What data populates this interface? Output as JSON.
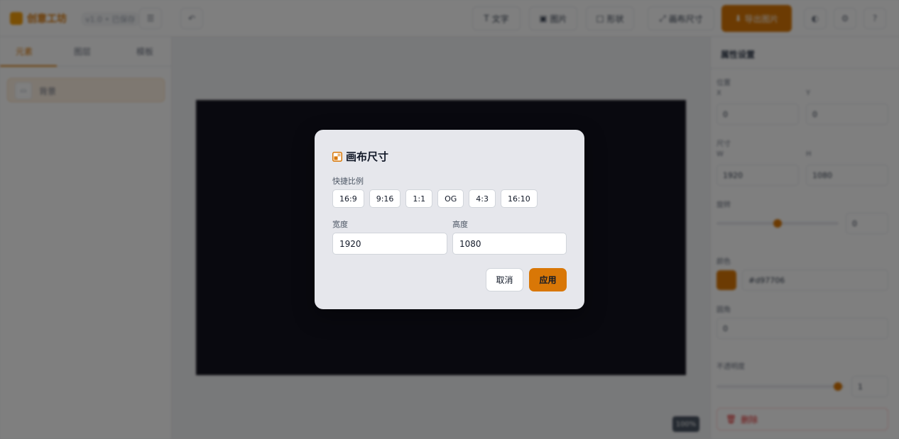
{
  "app": {
    "logo_text": "创意工坊",
    "version": "v1.0 • 已保存",
    "toolbar": {
      "btn1": "文字",
      "btn2": "图片",
      "btn3": "形状",
      "btn4": "画布尺寸",
      "primary": "导出图片"
    },
    "sidebar": {
      "tabs": [
        "元素",
        "图层",
        "模板"
      ],
      "layer_item": "背景"
    },
    "zoom": "100%",
    "props": {
      "title": "属性设置",
      "position_label": "位置",
      "x_label": "X",
      "y_label": "Y",
      "x_value": "0",
      "y_value": "0",
      "size_label": "尺寸",
      "w_label": "W",
      "h_label": "H",
      "w_value": "1920",
      "h_value": "1080",
      "rotation_label": "旋转",
      "rotation_value": "0",
      "color_label": "颜色",
      "color_value": "#d97706",
      "radius_label": "圆角",
      "radius_value": "0",
      "opacity_label": "不透明度",
      "opacity_value": "1",
      "delete_label": "删除"
    }
  },
  "modal": {
    "title": "画布尺寸",
    "presets_label": "快捷比例",
    "presets": [
      "16:9",
      "9:16",
      "1:1",
      "OG",
      "4:3",
      "16:10"
    ],
    "width_label": "宽度",
    "width_value": "1920",
    "height_label": "高度",
    "height_value": "1080",
    "cancel_label": "取消",
    "apply_label": "应用"
  },
  "colors": {
    "accent": "#d97706",
    "canvas_bg": "#13131f",
    "modal_bg": "#e6e7ec"
  }
}
